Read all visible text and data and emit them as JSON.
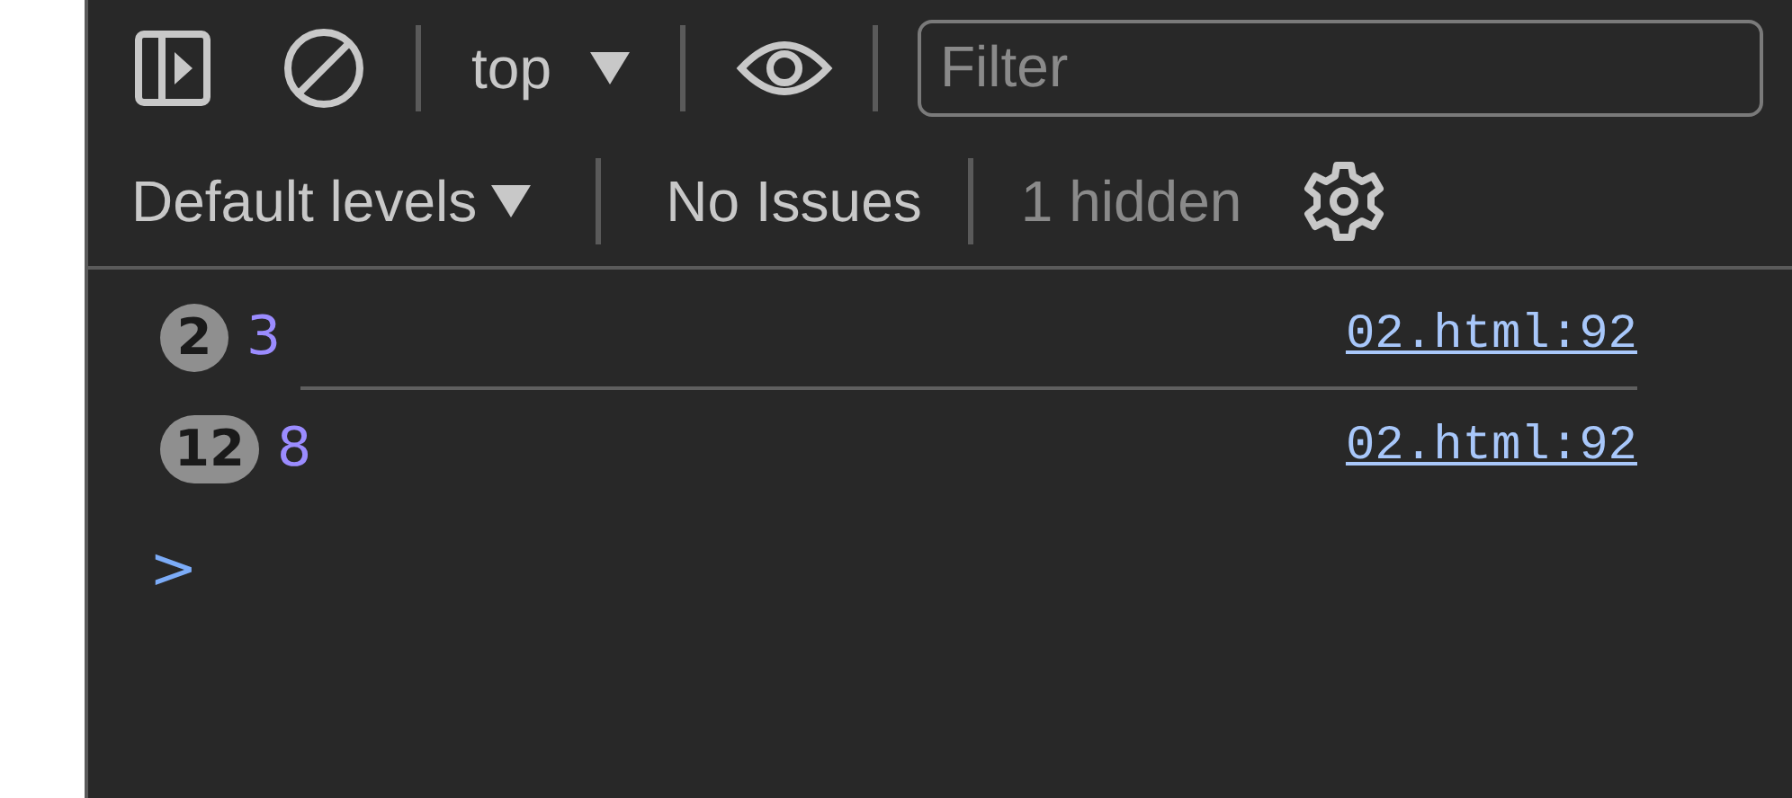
{
  "toolbar": {
    "context": "top",
    "filter": {
      "placeholder": "Filter"
    }
  },
  "levels_bar": {
    "levels": "Default levels",
    "issues": "No Issues",
    "hidden": "1 hidden"
  },
  "messages": [
    {
      "count": "2",
      "value": "3",
      "source": "02.html:92"
    },
    {
      "count": "12",
      "value": "8",
      "source": "02.html:92"
    }
  ],
  "prompt": ">"
}
